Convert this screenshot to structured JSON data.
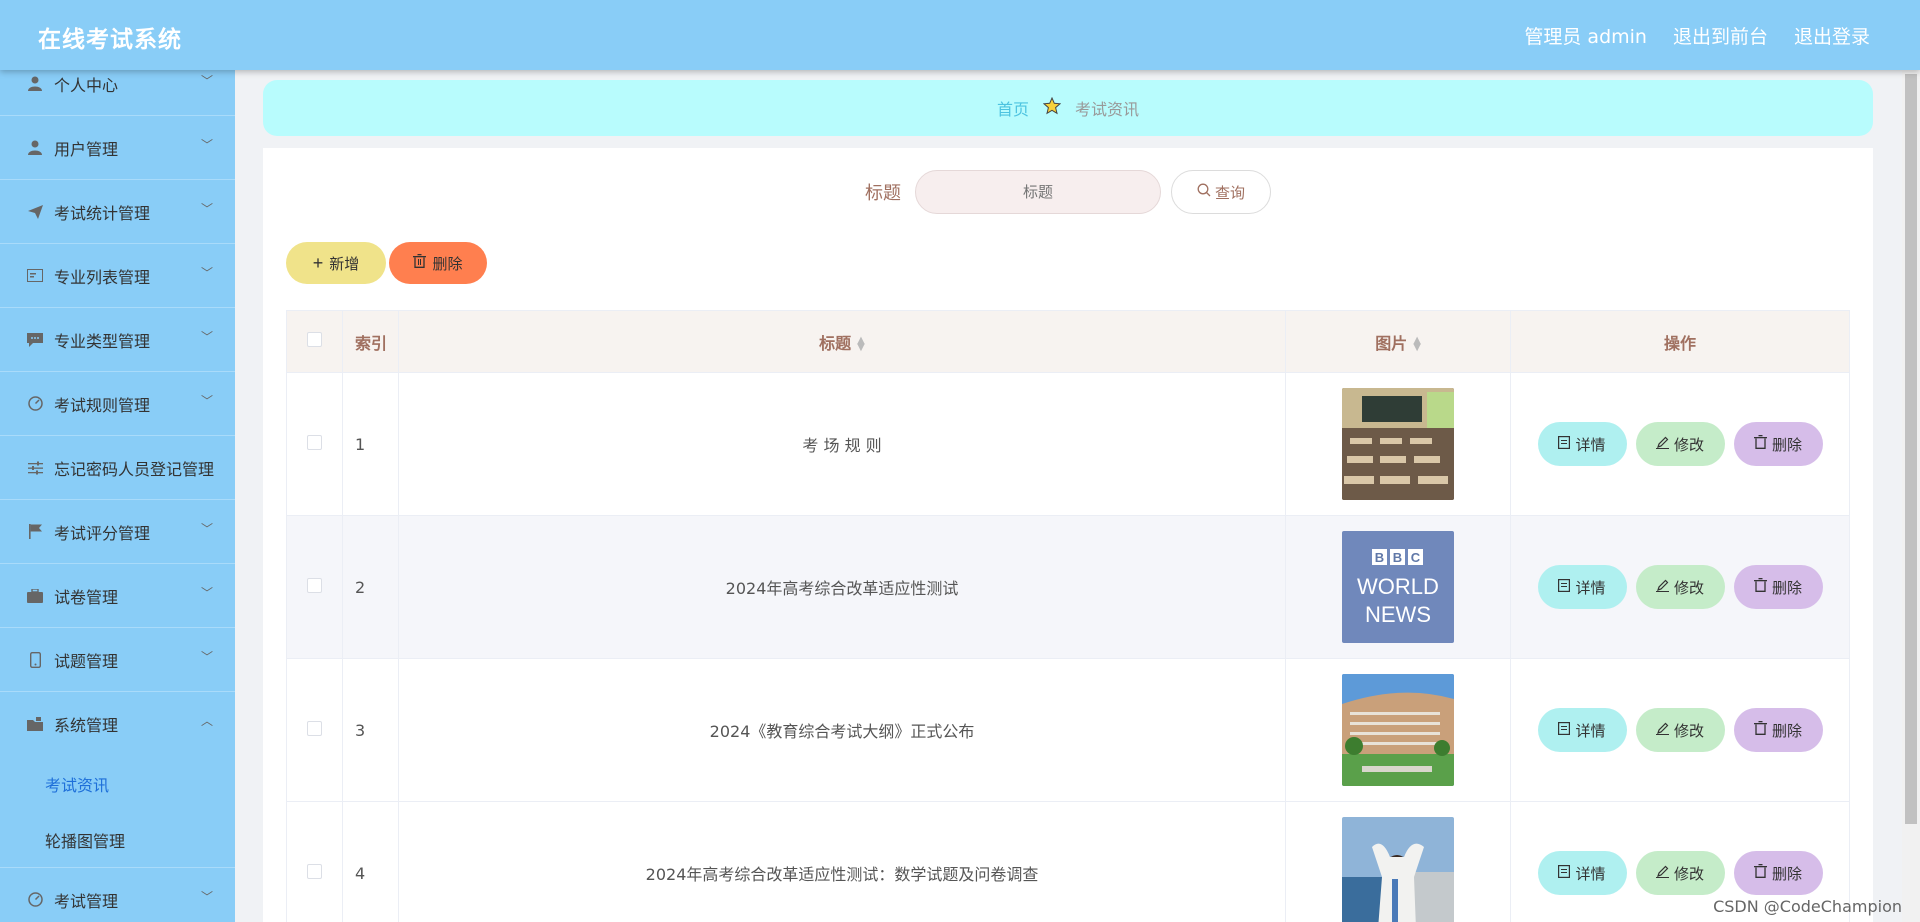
{
  "app": {
    "title": "在线考试系统"
  },
  "header": {
    "user": "管理员 admin",
    "to_front": "退出到前台",
    "logout": "退出登录"
  },
  "sidebar": {
    "items": [
      {
        "label": "个人中心",
        "icon": "user-icon"
      },
      {
        "label": "用户管理",
        "icon": "user-icon"
      },
      {
        "label": "考试统计管理",
        "icon": "send-icon"
      },
      {
        "label": "专业列表管理",
        "icon": "card-icon"
      },
      {
        "label": "专业类型管理",
        "icon": "chat-icon"
      },
      {
        "label": "考试规则管理",
        "icon": "gauge-icon"
      },
      {
        "label": "忘记密码人员登记管理",
        "icon": "sliders-icon"
      },
      {
        "label": "考试评分管理",
        "icon": "flag-icon"
      },
      {
        "label": "试卷管理",
        "icon": "briefcase-icon"
      },
      {
        "label": "试题管理",
        "icon": "phone-icon"
      },
      {
        "label": "系统管理",
        "icon": "folder-icon"
      }
    ],
    "sub_items": [
      {
        "label": "考试资讯",
        "active": true
      },
      {
        "label": "轮播图管理",
        "active": false
      }
    ],
    "last_item": {
      "label": "考试管理",
      "icon": "gauge-icon"
    }
  },
  "breadcrumb": {
    "home": "首页",
    "current": "考试资讯"
  },
  "search": {
    "label": "标题",
    "placeholder": "标题",
    "button": "查询"
  },
  "actions": {
    "add": "新增",
    "delete": "删除"
  },
  "table": {
    "headers": {
      "index": "索引",
      "title": "标题",
      "image": "图片",
      "operation": "操作"
    },
    "rows": [
      {
        "index": "1",
        "title": "考 场 规 则",
        "image": "classroom"
      },
      {
        "index": "2",
        "title": "2024年高考综合改革适应性测试",
        "image": "bbc-world-news",
        "image_text": [
          "B",
          "B",
          "C",
          "WORLD",
          "NEWS"
        ]
      },
      {
        "index": "3",
        "title": "2024《教育综合考试大纲》正式公布",
        "image": "campus-building"
      },
      {
        "index": "4",
        "title": "2024年高考综合改革适应性测试：数学试题及问卷调查",
        "image": "student-photo"
      }
    ],
    "row_actions": {
      "detail": "详情",
      "edit": "修改",
      "delete": "删除"
    }
  },
  "watermark": "CSDN @CodeChampion",
  "colors": {
    "header": "#89cdf7",
    "sidebar": "#89cdf7",
    "breadcrumb": "#b8fcfd",
    "add_btn": "#f0e38a",
    "del_btn": "#ff7f4f",
    "detail_btn": "#aff0f0",
    "edit_btn": "#c5ecc9",
    "delete_btn": "#d6bde9"
  }
}
